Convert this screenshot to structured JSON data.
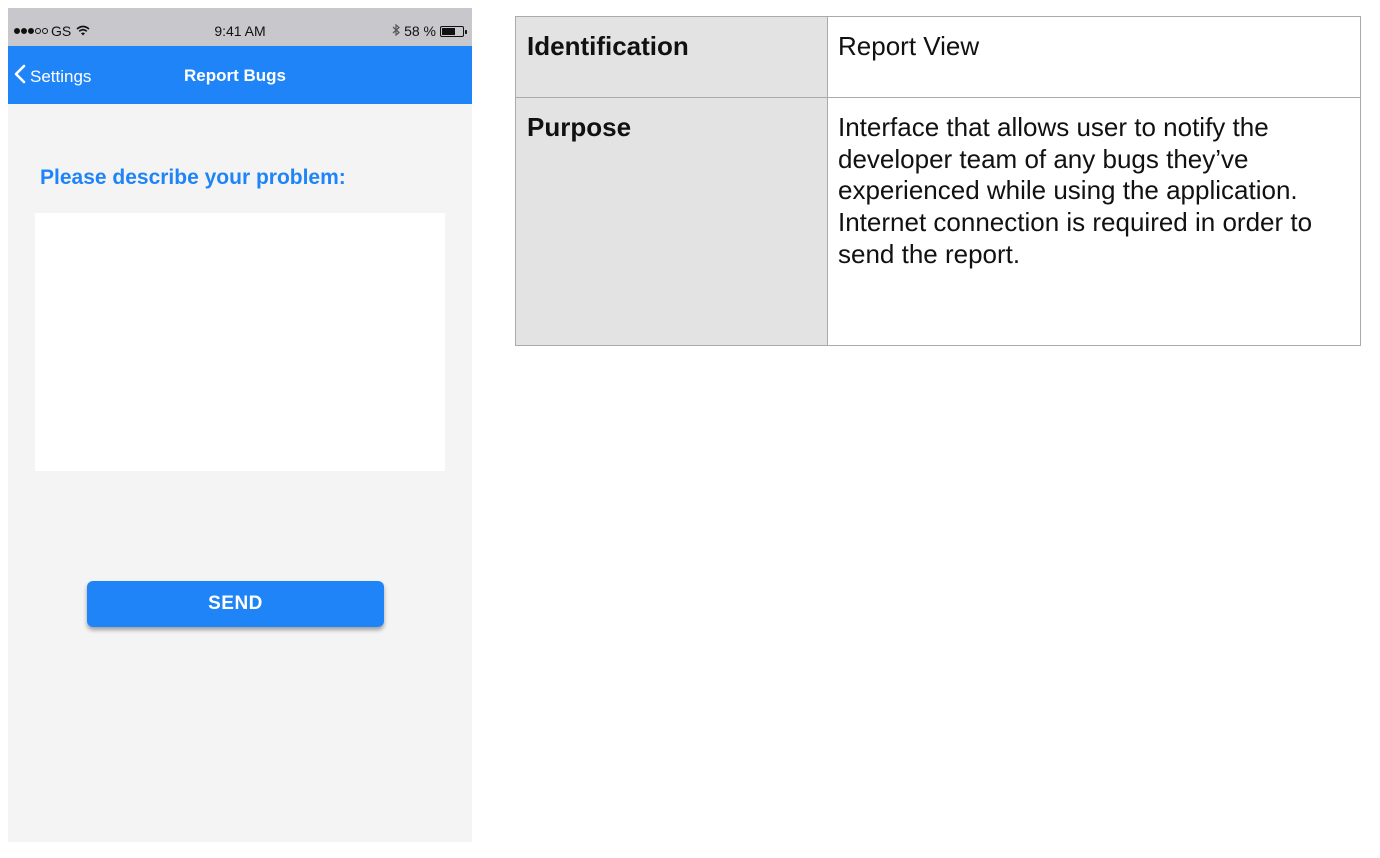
{
  "status_bar": {
    "carrier": "GS",
    "time": "9:41 AM",
    "battery": "58 %",
    "signal_bars_filled": 3,
    "signal_bars_total": 5,
    "battery_level": 0.58
  },
  "nav_bar": {
    "back_label": "Settings",
    "title": "Report Bugs"
  },
  "form": {
    "prompt": "Please describe your problem:",
    "problem_text": "",
    "send_label": "SEND"
  },
  "table": {
    "rows": [
      {
        "label": "Identification",
        "value": "Report View"
      },
      {
        "label": "Purpose",
        "value": "Interface that allows user to notify the developer team of any bugs they’ve experienced while using the application. Internet connection is required in order to send the report."
      }
    ]
  },
  "colors": {
    "accent": "#1f84f7",
    "status_bar_bg": "#c8c8cc",
    "screen_bg": "#f4f4f4",
    "table_label_bg": "#e3e3e3"
  }
}
